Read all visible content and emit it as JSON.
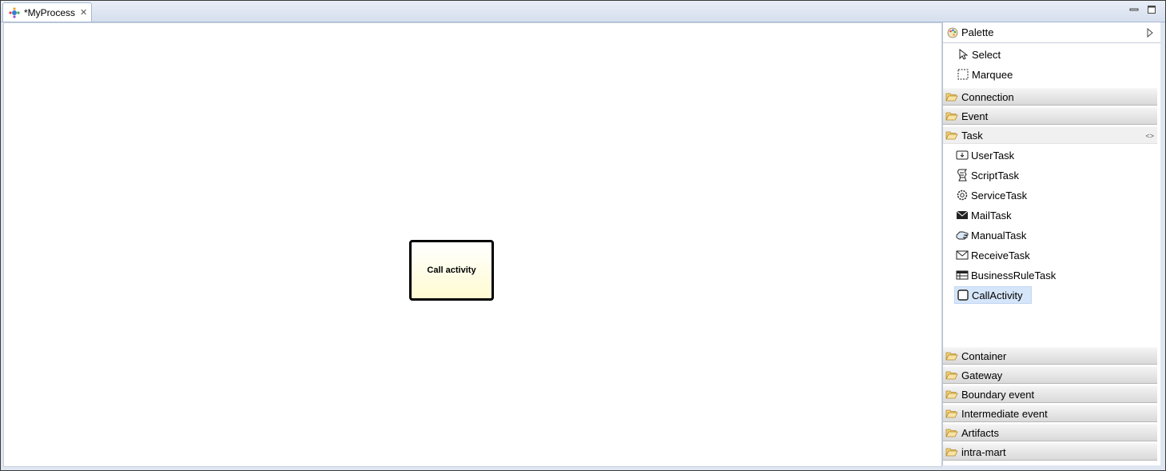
{
  "tab": {
    "title": "*MyProcess"
  },
  "canvas": {
    "call_activity_label": "Call activity"
  },
  "palette": {
    "title": "Palette",
    "tools": [
      {
        "label": "Select",
        "icon": "arrow-pointer-icon"
      },
      {
        "label": "Marquee",
        "icon": "marquee-icon"
      }
    ],
    "drawers_top": [
      {
        "label": "Connection"
      },
      {
        "label": "Event"
      }
    ],
    "task_drawer": {
      "label": "Task",
      "items": [
        {
          "label": "UserTask",
          "icon": "user-task-icon"
        },
        {
          "label": "ScriptTask",
          "icon": "script-task-icon"
        },
        {
          "label": "ServiceTask",
          "icon": "service-task-icon"
        },
        {
          "label": "MailTask",
          "icon": "mail-task-icon"
        },
        {
          "label": "ManualTask",
          "icon": "manual-task-icon"
        },
        {
          "label": "ReceiveTask",
          "icon": "receive-task-icon"
        },
        {
          "label": "BusinessRuleTask",
          "icon": "business-rule-task-icon"
        },
        {
          "label": "CallActivity",
          "icon": "call-activity-icon",
          "selected": true
        }
      ]
    },
    "drawers_bottom": [
      {
        "label": "Container"
      },
      {
        "label": "Gateway"
      },
      {
        "label": "Boundary event"
      },
      {
        "label": "Intermediate event"
      },
      {
        "label": "Artifacts"
      },
      {
        "label": "intra-mart"
      }
    ]
  },
  "colors": {
    "accent": "#d6e6fa",
    "task_fill": "#fffbd2",
    "frame": "#dfe6f1"
  }
}
